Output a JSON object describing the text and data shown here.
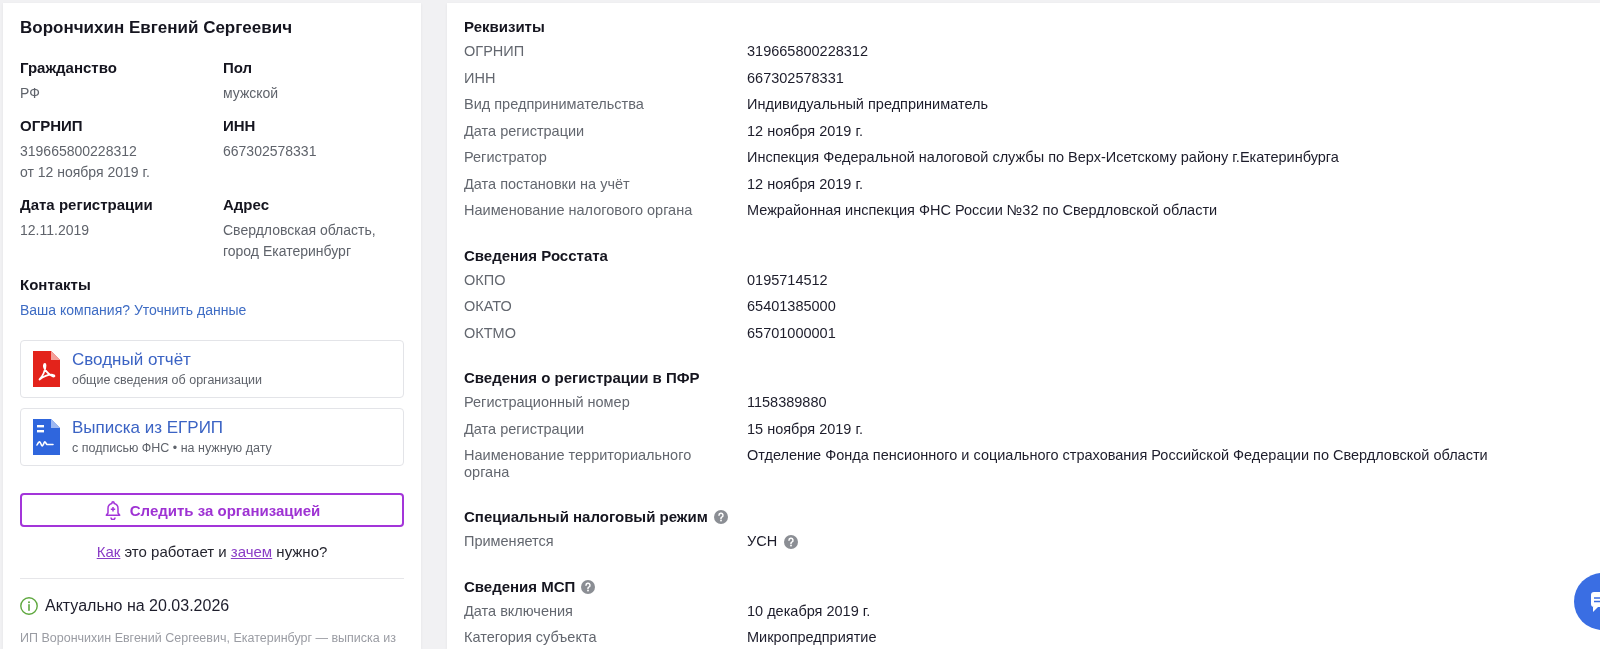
{
  "profile": {
    "name": "Ворончихин Евгений Сергеевич",
    "fields": [
      {
        "label": "Гражданство",
        "lines": [
          "РФ"
        ]
      },
      {
        "label": "Пол",
        "lines": [
          "мужской"
        ]
      },
      {
        "label": "ОГРНИП",
        "lines": [
          "319665800228312",
          "от 12 ноября 2019 г."
        ]
      },
      {
        "label": "ИНН",
        "lines": [
          "667302578331"
        ]
      },
      {
        "label": "Дата регистрации",
        "lines": [
          "12.11.2019"
        ]
      },
      {
        "label": "Адрес",
        "lines": [
          "Свердловская область,",
          "город Екатеринбург"
        ]
      }
    ]
  },
  "contacts": {
    "title": "Контакты",
    "link": "Ваша компания? Уточнить данные"
  },
  "documents": [
    {
      "kind": "pdf",
      "title": "Сводный отчёт",
      "subtitle": "общие сведения об организации"
    },
    {
      "kind": "extract",
      "title": "Выписка из ЕГРИП",
      "subtitle": "с подписью ФНС • на нужную дату"
    }
  ],
  "follow_button": {
    "label": "Следить за организацией"
  },
  "help_text": [
    {
      "kind": "link",
      "text": "Как"
    },
    {
      "kind": "text",
      "text": " это работает и "
    },
    {
      "kind": "link",
      "text": "зачем"
    },
    {
      "kind": "text",
      "text": " нужно?"
    }
  ],
  "status": {
    "text": "Актуально на 20.03.2026"
  },
  "footer_note": "ИП Ворончихин Евгений Сергеевич, Екатеринбург — выписка из",
  "details": {
    "sections": [
      {
        "title": "Реквизиты",
        "help": false,
        "rows": [
          {
            "label": "ОГРНИП",
            "value": "319665800228312",
            "help": false
          },
          {
            "label": "ИНН",
            "value": "667302578331",
            "help": false
          },
          {
            "label": "Вид предпринимательства",
            "value": "Индивидуальный предприниматель",
            "help": false
          },
          {
            "label": "Дата регистрации",
            "value": "12 ноября 2019 г.",
            "help": false
          },
          {
            "label": "Регистратор",
            "value": "Инспекция Федеральной налоговой службы по Верх-Исетскому району г.Екатеринбурга",
            "help": false
          },
          {
            "label": "Дата постановки на учёт",
            "value": "12 ноября 2019 г.",
            "help": false
          },
          {
            "label": "Наименование налогового органа",
            "value": "Межрайонная инспекция ФНС России №32 по Свердловской области",
            "help": false
          }
        ]
      },
      {
        "title": "Сведения Росстата",
        "help": false,
        "rows": [
          {
            "label": "ОКПО",
            "value": "0195714512",
            "help": false
          },
          {
            "label": "ОКАТО",
            "value": "65401385000",
            "help": false
          },
          {
            "label": "ОКТМО",
            "value": "65701000001",
            "help": false
          }
        ]
      },
      {
        "title": "Сведения о регистрации в ПФР",
        "help": false,
        "rows": [
          {
            "label": "Регистрационный номер",
            "value": "1158389880",
            "help": false
          },
          {
            "label": "Дата регистрации",
            "value": "15 ноября 2019 г.",
            "help": false
          },
          {
            "label": "Наименование территориального органа",
            "value": "Отделение Фонда пенсионного и социального страхования Российской Федерации по Свердловской области",
            "help": false
          }
        ]
      },
      {
        "title": "Специальный налоговый режим",
        "help": true,
        "rows": [
          {
            "label": "Применяется",
            "value": "УСН",
            "help": true
          }
        ]
      },
      {
        "title": "Сведения МСП",
        "help": true,
        "rows": [
          {
            "label": "Дата включения",
            "value": "10 декабря 2019 г.",
            "help": false
          },
          {
            "label": "Категория субъекта",
            "value": "Микропредприятие",
            "help": false
          }
        ]
      }
    ]
  }
}
